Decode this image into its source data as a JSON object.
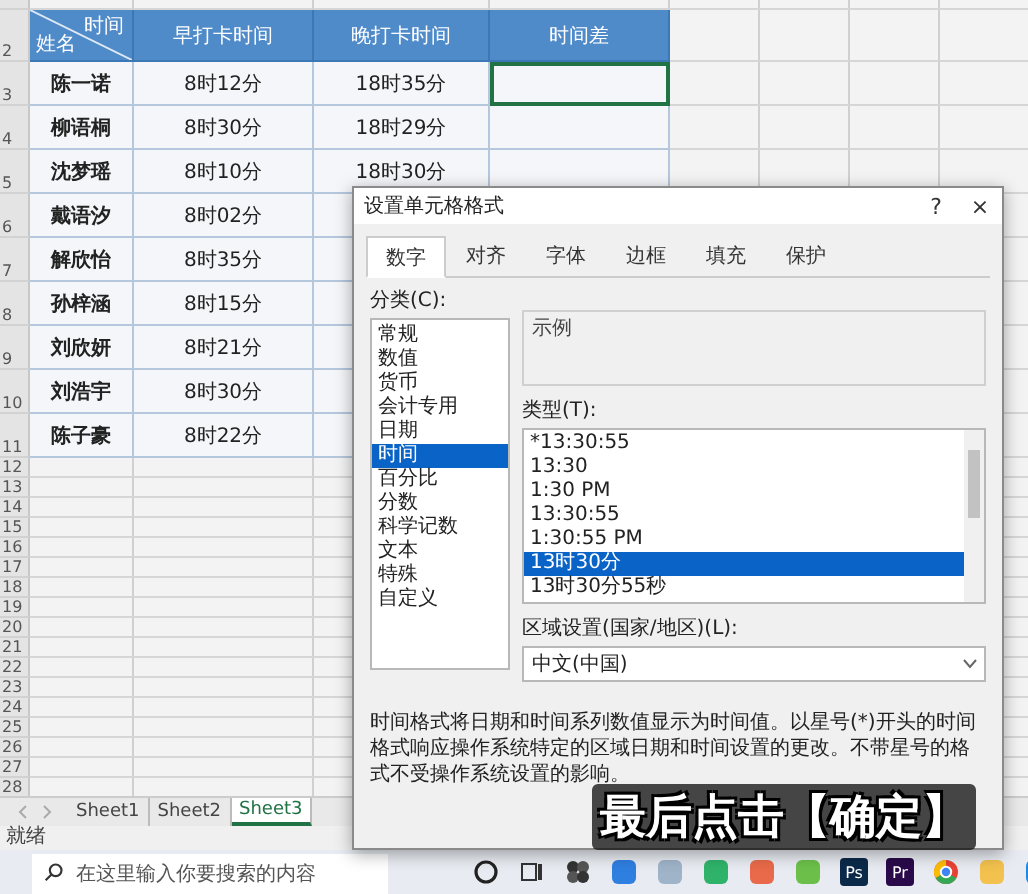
{
  "sheet": {
    "corner": {
      "top": "时间",
      "bottom": "姓名"
    },
    "header_row_number": "2",
    "columns": [
      "早打卡时间",
      "晚打卡时间",
      "时间差"
    ],
    "rows": [
      {
        "number": "3",
        "name": "陈一诺",
        "morning": "8时12分",
        "evening": "18时35分",
        "selected": true
      },
      {
        "number": "4",
        "name": "柳语桐",
        "morning": "8时30分",
        "evening": "18时29分",
        "selected": false
      },
      {
        "number": "5",
        "name": "沈梦瑶",
        "morning": "8时10分",
        "evening": "18时30分",
        "selected": false
      },
      {
        "number": "6",
        "name": "戴语汐",
        "morning": "8时02分"
      },
      {
        "number": "7",
        "name": "解欣怡",
        "morning": "8时35分"
      },
      {
        "number": "8",
        "name": "孙梓涵",
        "morning": "8时15分"
      },
      {
        "number": "9",
        "name": "刘欣妍",
        "morning": "8时21分"
      },
      {
        "number": "10",
        "name": "刘浩宇",
        "morning": "8时30分"
      },
      {
        "number": "11",
        "name": "陈子豪",
        "morning": "8时22分"
      }
    ],
    "empty_rows": [
      "12",
      "13",
      "14",
      "15",
      "16",
      "17",
      "18",
      "19",
      "20",
      "21",
      "22",
      "23",
      "24",
      "25",
      "26",
      "27",
      "28"
    ]
  },
  "sheet_tabs": [
    {
      "label": "Sheet1",
      "selected": false
    },
    {
      "label": "Sheet2",
      "selected": false
    },
    {
      "label": "Sheet3",
      "selected": true
    }
  ],
  "status_bar": "就绪",
  "taskbar": {
    "search_placeholder": "在这里输入你要搜索的内容",
    "apps": [
      {
        "kind": "ring"
      },
      {
        "kind": "taskview"
      },
      {
        "kind": "fan"
      },
      {
        "kind": "tile",
        "color": "#2f7fe0"
      },
      {
        "kind": "tile",
        "color": "#9fb4c8"
      },
      {
        "kind": "tile",
        "color": "#2fb36a"
      },
      {
        "kind": "tile",
        "color": "#e86a4a"
      },
      {
        "kind": "tile",
        "color": "#6cc04a"
      },
      {
        "kind": "letter",
        "label": "Ps",
        "color": "#0b2a4a"
      },
      {
        "kind": "letter",
        "label": "Pr",
        "color": "#2a0a4a"
      },
      {
        "kind": "chrome"
      },
      {
        "kind": "tile",
        "color": "#f2c14e"
      },
      {
        "kind": "tile",
        "color": "#1e88e5"
      }
    ]
  },
  "dialog": {
    "title": "设置单元格格式",
    "help": "?",
    "close": "×",
    "tabs": [
      {
        "label": "数字",
        "selected": true
      },
      {
        "label": "对齐",
        "selected": false
      },
      {
        "label": "字体",
        "selected": false
      },
      {
        "label": "边框",
        "selected": false
      },
      {
        "label": "填充",
        "selected": false
      },
      {
        "label": "保护",
        "selected": false
      }
    ],
    "category_label": "分类(C):",
    "categories": [
      {
        "label": "常规",
        "selected": false
      },
      {
        "label": "数值",
        "selected": false
      },
      {
        "label": "货币",
        "selected": false
      },
      {
        "label": "会计专用",
        "selected": false
      },
      {
        "label": "日期",
        "selected": false
      },
      {
        "label": "时间",
        "selected": true
      },
      {
        "label": "百分比",
        "selected": false
      },
      {
        "label": "分数",
        "selected": false
      },
      {
        "label": "科学记数",
        "selected": false
      },
      {
        "label": "文本",
        "selected": false
      },
      {
        "label": "特殊",
        "selected": false
      },
      {
        "label": "自定义",
        "selected": false
      }
    ],
    "sample_label": "示例",
    "type_label": "类型(T):",
    "types": [
      {
        "label": "*13:30:55",
        "selected": false
      },
      {
        "label": "13:30",
        "selected": false
      },
      {
        "label": "1:30 PM",
        "selected": false
      },
      {
        "label": "13:30:55",
        "selected": false
      },
      {
        "label": "1:30:55 PM",
        "selected": false
      },
      {
        "label": "13时30分",
        "selected": true
      },
      {
        "label": "13时30分55秒",
        "selected": false
      }
    ],
    "locale_label": "区域设置(国家/地区)(L):",
    "locale_value": "中文(中国)",
    "description": "时间格式将日期和时间系列数值显示为时间值。以星号(*)开头的时间格式响应操作系统特定的区域日期和时间设置的更改。不带星号的格式不受操作系统设置的影响。"
  },
  "caption": "最后点击【确定】"
}
